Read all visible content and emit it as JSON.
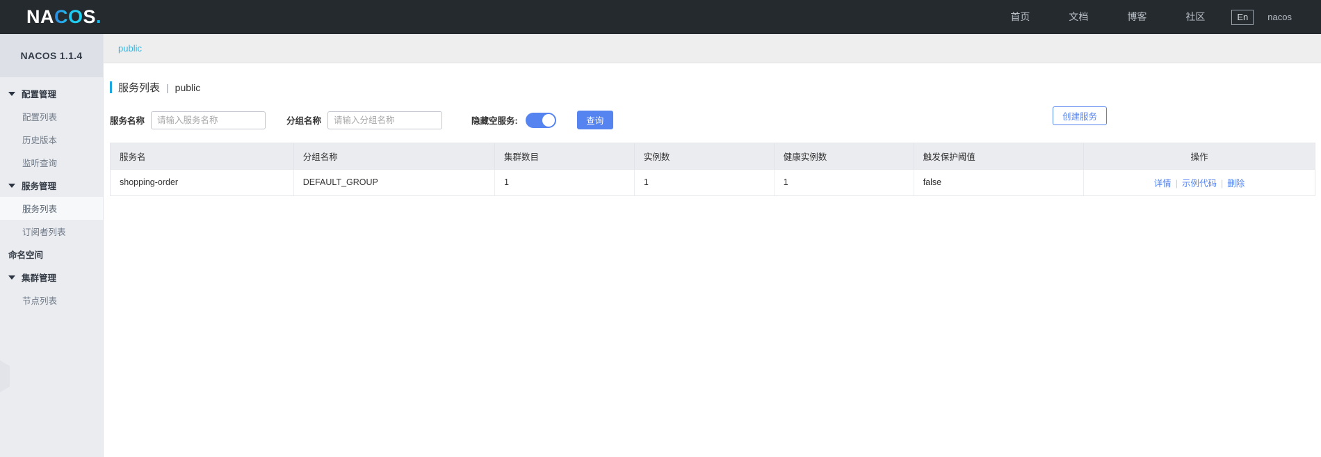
{
  "brand": {
    "logo_part1": "NA",
    "logo_part2": "CO",
    "logo_part3": "S",
    "logo_dot": ".",
    "accent_blue": "#1fb6e8"
  },
  "header": {
    "nav": [
      {
        "label": "首页",
        "name": "nav-home"
      },
      {
        "label": "文档",
        "name": "nav-docs"
      },
      {
        "label": "博客",
        "name": "nav-blog"
      },
      {
        "label": "社区",
        "name": "nav-community"
      }
    ],
    "language_toggle": "En",
    "user": "nacos"
  },
  "sidebar": {
    "title": "NACOS 1.1.4",
    "groups": [
      {
        "label": "配置管理",
        "name": "sidebar-group-config",
        "items": [
          {
            "label": "配置列表",
            "name": "sidebar-item-config-list",
            "active": false
          },
          {
            "label": "历史版本",
            "name": "sidebar-item-history",
            "active": false
          },
          {
            "label": "监听查询",
            "name": "sidebar-item-listener-query",
            "active": false
          }
        ]
      },
      {
        "label": "服务管理",
        "name": "sidebar-group-service",
        "items": [
          {
            "label": "服务列表",
            "name": "sidebar-item-service-list",
            "active": true
          },
          {
            "label": "订阅者列表",
            "name": "sidebar-item-subscriber-list",
            "active": false
          }
        ]
      }
    ],
    "namespace_link": "命名空间",
    "cluster_group": {
      "label": "集群管理",
      "items": [
        {
          "label": "节点列表",
          "name": "sidebar-item-node-list",
          "active": false
        }
      ]
    }
  },
  "breadcrumb": {
    "current": "public"
  },
  "page": {
    "title": "服务列表",
    "separator": "|",
    "namespace": "public"
  },
  "filters": {
    "service_name_label": "服务名称",
    "service_name_value": "",
    "service_name_placeholder": "请输入服务名称",
    "group_name_label": "分组名称",
    "group_name_value": "",
    "group_name_placeholder": "请输入分组名称",
    "hide_empty_label": "隐藏空服务:",
    "hide_empty_on": true,
    "query_button": "查询",
    "create_button": "创建服务"
  },
  "table": {
    "columns": [
      "服务名",
      "分组名称",
      "集群数目",
      "实例数",
      "健康实例数",
      "触发保护阈值",
      "操作"
    ],
    "rows": [
      {
        "service_name": "shopping-order",
        "group_name": "DEFAULT_GROUP",
        "cluster_count": "1",
        "instance_count": "1",
        "healthy_instance_count": "1",
        "protect_threshold": "false",
        "actions": [
          {
            "label": "详情",
            "name": "row-action-detail"
          },
          {
            "label": "示例代码",
            "name": "row-action-sample-code"
          },
          {
            "label": "删除",
            "name": "row-action-delete"
          }
        ],
        "action_separator": "|"
      }
    ]
  }
}
